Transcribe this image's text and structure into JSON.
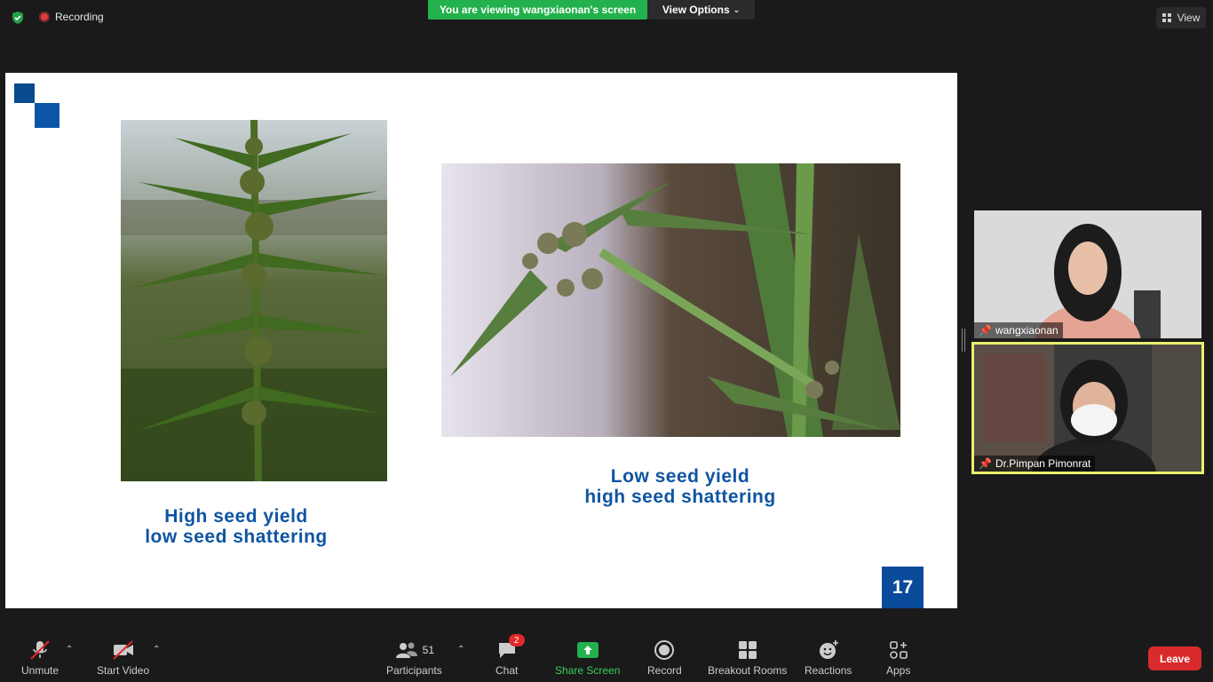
{
  "topbar": {
    "recording_label": "Recording",
    "viewing_banner": "You are viewing wangxiaonan's screen",
    "view_options_label": "View Options",
    "view_label": "View"
  },
  "slide": {
    "caption_left_line1": "High seed yield",
    "caption_left_line2": "low seed shattering",
    "caption_right_line1": "Low seed yield",
    "caption_right_line2": "high seed shattering",
    "page_number": "17",
    "accent_color": "#0a4a9a"
  },
  "participants_tiles": [
    {
      "name": "wangxiaonan"
    },
    {
      "name": "Dr.Pimpan Pimonrat"
    }
  ],
  "toolbar": {
    "unmute": "Unmute",
    "start_video": "Start Video",
    "participants": "Participants",
    "participants_count": "51",
    "chat": "Chat",
    "chat_badge": "2",
    "share_screen": "Share Screen",
    "record": "Record",
    "breakout_rooms": "Breakout Rooms",
    "reactions": "Reactions",
    "apps": "Apps",
    "leave": "Leave"
  },
  "colors": {
    "share_green": "#22b14c",
    "leave_red": "#d92b2b",
    "active_speaker_border": "#e9f06e"
  }
}
